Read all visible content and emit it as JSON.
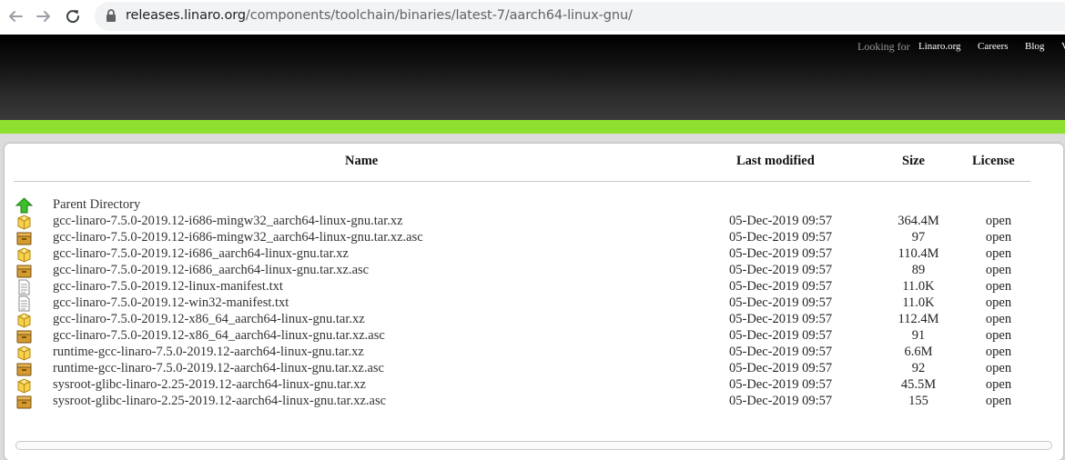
{
  "browser": {
    "url_host": "releases.linaro.org",
    "url_path": "/components/toolchain/binaries/latest-7/aarch64-linux-gnu/",
    "back_icon": "arrow-left-icon",
    "forward_icon": "arrow-right-icon",
    "reload_icon": "reload-icon",
    "lock_icon": "lock-icon"
  },
  "site": {
    "looking_for": "Looking for",
    "nav": [
      "Linaro.org",
      "Careers",
      "Blog",
      "V"
    ],
    "accent_color": "#8ee030"
  },
  "table": {
    "headers": {
      "name": "Name",
      "last_modified": "Last modified",
      "size": "Size",
      "license": "License"
    },
    "parent": {
      "name": "Parent Directory",
      "icon": "up-arrow-icon"
    },
    "rows": [
      {
        "icon": "archive-icon",
        "name": "gcc-linaro-7.5.0-2019.12-i686-mingw32_aarch64-linux-gnu.tar.xz",
        "date": "05-Dec-2019 09:57",
        "size": "364.4M",
        "license": "open"
      },
      {
        "icon": "box-icon",
        "name": "gcc-linaro-7.5.0-2019.12-i686-mingw32_aarch64-linux-gnu.tar.xz.asc",
        "date": "05-Dec-2019 09:57",
        "size": "97",
        "license": "open"
      },
      {
        "icon": "archive-icon",
        "name": "gcc-linaro-7.5.0-2019.12-i686_aarch64-linux-gnu.tar.xz",
        "date": "05-Dec-2019 09:57",
        "size": "110.4M",
        "license": "open"
      },
      {
        "icon": "box-icon",
        "name": "gcc-linaro-7.5.0-2019.12-i686_aarch64-linux-gnu.tar.xz.asc",
        "date": "05-Dec-2019 09:57",
        "size": "89",
        "license": "open"
      },
      {
        "icon": "text-file-icon",
        "name": "gcc-linaro-7.5.0-2019.12-linux-manifest.txt",
        "date": "05-Dec-2019 09:57",
        "size": "11.0K",
        "license": "open"
      },
      {
        "icon": "text-file-icon",
        "name": "gcc-linaro-7.5.0-2019.12-win32-manifest.txt",
        "date": "05-Dec-2019 09:57",
        "size": "11.0K",
        "license": "open"
      },
      {
        "icon": "archive-icon",
        "name": "gcc-linaro-7.5.0-2019.12-x86_64_aarch64-linux-gnu.tar.xz",
        "date": "05-Dec-2019 09:57",
        "size": "112.4M",
        "license": "open"
      },
      {
        "icon": "box-icon",
        "name": "gcc-linaro-7.5.0-2019.12-x86_64_aarch64-linux-gnu.tar.xz.asc",
        "date": "05-Dec-2019 09:57",
        "size": "91",
        "license": "open"
      },
      {
        "icon": "archive-icon",
        "name": "runtime-gcc-linaro-7.5.0-2019.12-aarch64-linux-gnu.tar.xz",
        "date": "05-Dec-2019 09:57",
        "size": "6.6M",
        "license": "open"
      },
      {
        "icon": "box-icon",
        "name": "runtime-gcc-linaro-7.5.0-2019.12-aarch64-linux-gnu.tar.xz.asc",
        "date": "05-Dec-2019 09:57",
        "size": "92",
        "license": "open"
      },
      {
        "icon": "archive-icon",
        "name": "sysroot-glibc-linaro-2.25-2019.12-aarch64-linux-gnu.tar.xz",
        "date": "05-Dec-2019 09:57",
        "size": "45.5M",
        "license": "open"
      },
      {
        "icon": "box-icon",
        "name": "sysroot-glibc-linaro-2.25-2019.12-aarch64-linux-gnu.tar.xz.asc",
        "date": "05-Dec-2019 09:57",
        "size": "155",
        "license": "open"
      }
    ]
  }
}
